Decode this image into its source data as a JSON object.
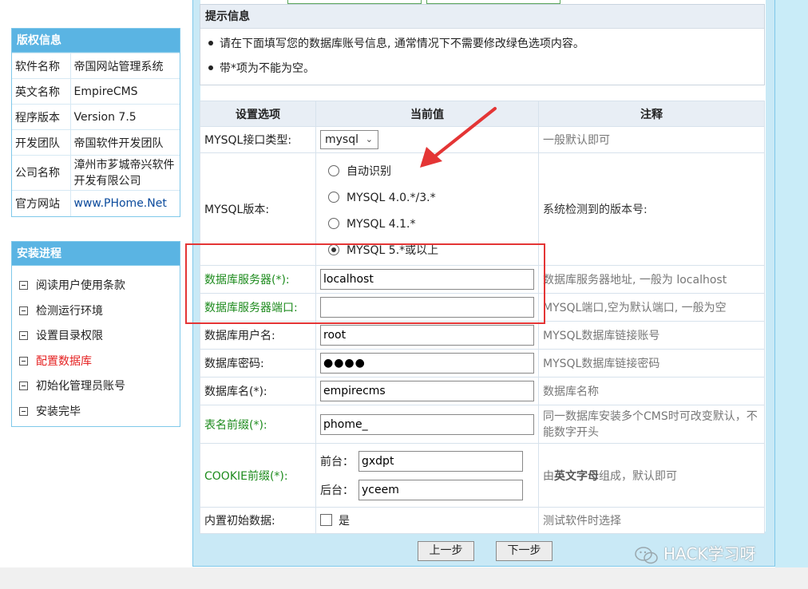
{
  "copyright": {
    "title": "版权信息",
    "rows": [
      {
        "key": "软件名称",
        "value": "帝国网站管理系统"
      },
      {
        "key": "英文名称",
        "value": "EmpireCMS"
      },
      {
        "key": "程序版本",
        "value": "Version 7.5"
      },
      {
        "key": "开发团队",
        "value": "帝国软件开发团队"
      },
      {
        "key": "公司名称",
        "value": "漳州市芗城帝兴软件开发有限公司"
      },
      {
        "key": "官方网站",
        "value": "www.PHome.Net"
      }
    ]
  },
  "progress": {
    "title": "安装进程",
    "steps": [
      "阅读用户使用条款",
      "检测运行环境",
      "设置目录权限",
      "配置数据库",
      "初始化管理员账号",
      "安装完毕"
    ],
    "active_index": 3
  },
  "notice": {
    "title": "提示信息",
    "lines": [
      "请在下面填写您的数据库账号信息, 通常情况下不需要修改绿色选项内容。",
      "带*项为不能为空。"
    ]
  },
  "settings": {
    "headers": {
      "option": "设置选项",
      "value": "当前值",
      "note": "注释"
    },
    "mysql_interface": {
      "label": "MYSQL接口类型:",
      "selected": "mysql",
      "note": "一般默认即可"
    },
    "mysql_version": {
      "label": "MYSQL版本:",
      "options": [
        "自动识别",
        "MYSQL 4.0.*/3.*",
        "MYSQL 4.1.*",
        "MYSQL 5.*或以上"
      ],
      "selected_index": 3,
      "note": "系统检测到的版本号:"
    },
    "db_server": {
      "label": "数据库服务器(*):",
      "value": "localhost",
      "note": "数据库服务器地址, 一般为 localhost"
    },
    "db_port": {
      "label": "数据库服务器端口:",
      "value": "",
      "note": "MYSQL端口,空为默认端口, 一般为空"
    },
    "db_user": {
      "label": "数据库用户名:",
      "value": "root",
      "note": "MYSQL数据库链接账号"
    },
    "db_password": {
      "label": "数据库密码:",
      "value": "●●●●",
      "note": "MYSQL数据库链接密码"
    },
    "db_name": {
      "label": "数据库名(*):",
      "value": "empirecms",
      "note": "数据库名称"
    },
    "table_prefix": {
      "label": "表名前缀(*):",
      "value": "phome_",
      "note": "同一数据库安装多个CMS时可改变默认，不能数字开头"
    },
    "cookie_prefix": {
      "label": "COOKIE前缀(*):",
      "front_label": "前台：",
      "front_value": "gxdpt",
      "back_label": "后台：",
      "back_value": "yceem",
      "note_pre": "由",
      "note_bold": "英文字母",
      "note_post": "组成，默认即可"
    },
    "init_data": {
      "label": "内置初始数据:",
      "checkbox_label": "是",
      "checked": false,
      "note": "测试软件时选择"
    }
  },
  "buttons": {
    "prev": "上一步",
    "next": "下一步"
  },
  "watermark": "HACK学习呀",
  "colors": {
    "header_blue": "#5ab4e3",
    "green_label": "#1d8b1d",
    "active_step": "#e52121",
    "highlight_red": "#e43535"
  }
}
